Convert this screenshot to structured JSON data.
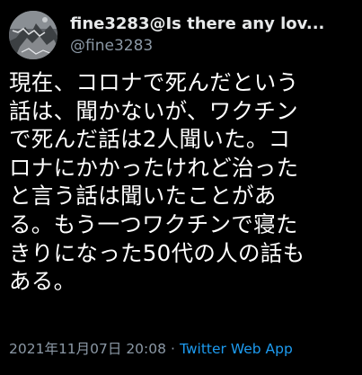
{
  "tweet": {
    "author": {
      "display_name": "fine3283@Is there any lov...",
      "handle": "@fine3283",
      "avatar_icon": "profile-photo-avatar"
    },
    "text_lines": [
      "現在、コロナで死んだという",
      "話は、聞かないが、ワクチン",
      "で死んだ話は2人聞いた。コ",
      "ロナにかかったけれど治った",
      "と言う話は聞いたことがあ",
      "る。もう一つワクチンで寝た",
      "きりになった50代の人の話も",
      "ある。"
    ],
    "timestamp": "2021年11月07日 20:08",
    "separator": "·",
    "source": "Twitter Web App"
  },
  "colors": {
    "background": "#000000",
    "text_primary": "#ffffff",
    "text_secondary": "#8b98a5",
    "link": "#1d9bf0"
  }
}
